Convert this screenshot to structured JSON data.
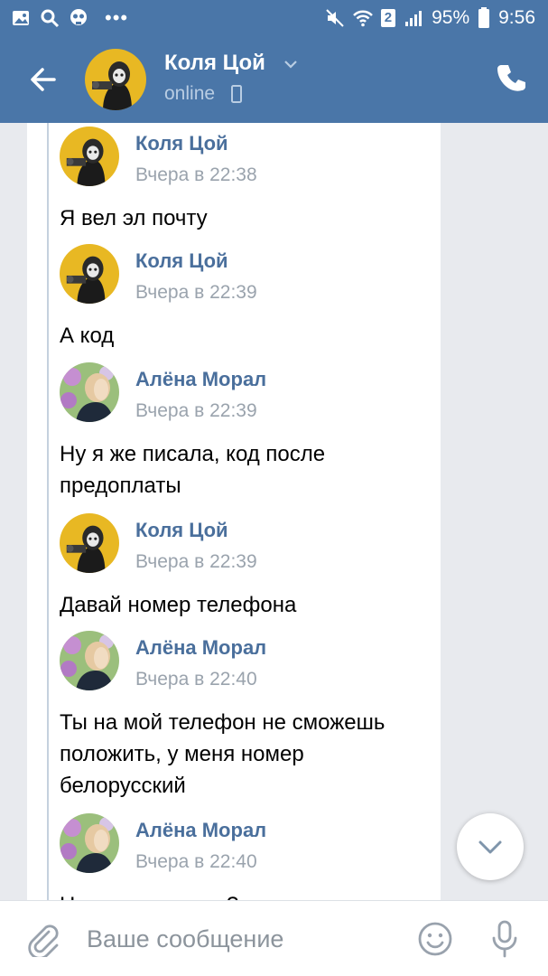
{
  "status_bar": {
    "notification_count": "2",
    "battery": "95%",
    "time": "9:56"
  },
  "header": {
    "name": "Коля Цой",
    "status": "online"
  },
  "messages": [
    {
      "author": "Коля Цой",
      "time": "Вчера в 22:38",
      "text": "Я вел эл почту"
    },
    {
      "author": "Коля Цой",
      "time": "Вчера в 22:39",
      "text": "А код"
    },
    {
      "author": "Алёна Морал",
      "time": "Вчера в 22:39",
      "text": "Ну я же писала, код после предоплаты"
    },
    {
      "author": "Коля Цой",
      "time": "Вчера в 22:39",
      "text": "Давай номер телефона"
    },
    {
      "author": "Алёна Морал",
      "time": "Вчера в 22:40",
      "text": "Ты на мой телефон не сможешь положить, у меня номер белорусский"
    },
    {
      "author": "Алёна Морал",
      "time": "Вчера в 22:40",
      "text": "На киви можешь?"
    }
  ],
  "composer": {
    "placeholder": "Ваше сообщение"
  },
  "colors": {
    "brand": "#4a76a8",
    "name_link": "#4a6f9c"
  },
  "icons": [
    "gallery-icon",
    "search-icon",
    "skull-icon",
    "more-icon",
    "mute-icon",
    "wifi-icon",
    "signal-icon",
    "battery-icon",
    "back-arrow-icon",
    "chevron-down-icon",
    "phone-icon",
    "scroll-down-icon",
    "attach-icon",
    "smile-icon",
    "mic-icon"
  ]
}
